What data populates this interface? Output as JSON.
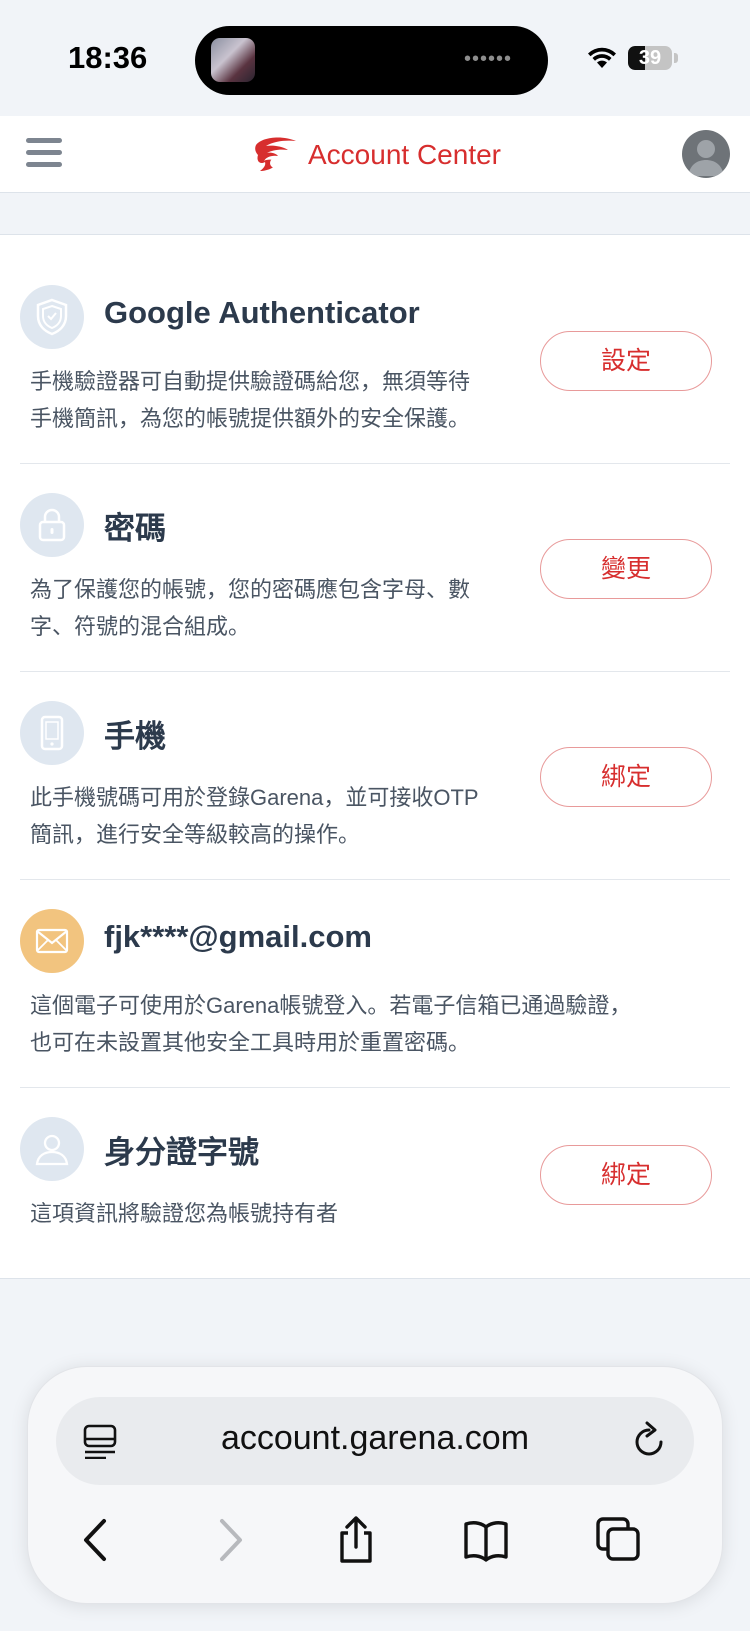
{
  "status_bar": {
    "time": "18:36",
    "battery": "39",
    "battery_level": 0.39
  },
  "header": {
    "title": "Account Center"
  },
  "security_items": [
    {
      "icon": "shield-icon",
      "title": "Google Authenticator",
      "description_line1": "手機驗證器可自動提供驗證碼給您，無須等待",
      "description_line2": "手機簡訊，為您的帳號提供額外的安全保護。",
      "button": "設定"
    },
    {
      "icon": "lock-icon",
      "title": "密碼",
      "description_line1": "為了保護您的帳號，您的密碼應包含字母、數",
      "description_line2": "字、符號的混合組成。",
      "button": "變更"
    },
    {
      "icon": "phone-icon",
      "title": "手機",
      "description_line1": "此手機號碼可用於登錄Garena，並可接收OTP",
      "description_line2": "簡訊，進行安全等級較高的操作。",
      "button": "綁定"
    },
    {
      "icon": "mail-icon",
      "title": "fjk****@gmail.com",
      "description_line1": "這個電子可使用於Garena帳號登入。若電子信箱已通過驗證，",
      "description_line2": "也可在未設置其他安全工具時用於重置密碼。"
    },
    {
      "icon": "id-user-icon",
      "title": "身分證字號",
      "description_line1": "這項資訊將驗證您為帳號持有者",
      "button": "綁定"
    }
  ],
  "browser": {
    "url": "account.garena.com"
  },
  "colors": {
    "brand_red": "#d72e2e",
    "button_border": "#e89a9a",
    "icon_bg": "#dfe7f0",
    "email_icon_bg": "#f2c47f",
    "page_bg": "#f1f4f8"
  }
}
